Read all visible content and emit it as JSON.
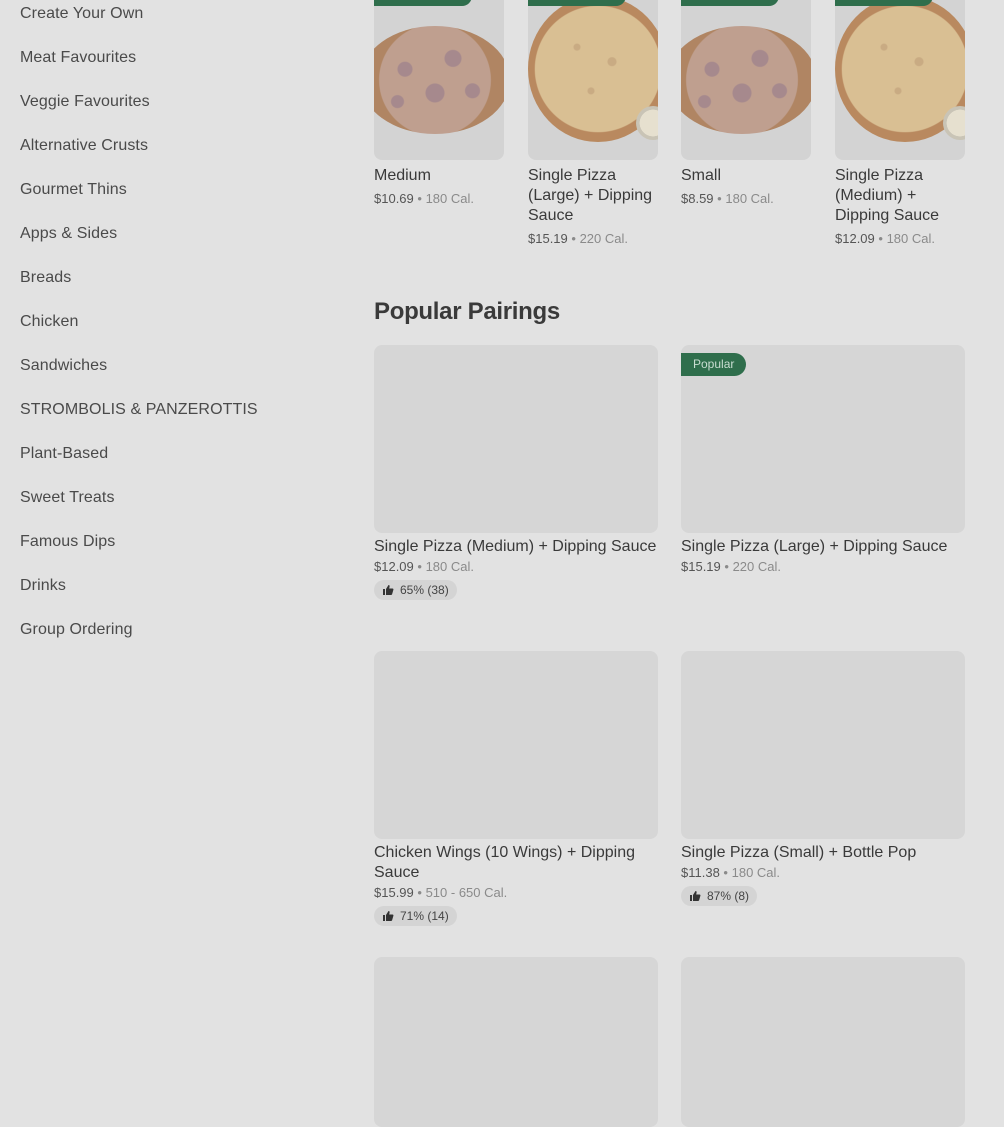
{
  "sidebar": {
    "items": [
      {
        "label": "Create Your Own"
      },
      {
        "label": "Meat Favourites"
      },
      {
        "label": "Veggie Favourites"
      },
      {
        "label": "Alternative Crusts"
      },
      {
        "label": "Gourmet Thins"
      },
      {
        "label": "Apps & Sides"
      },
      {
        "label": "Breads"
      },
      {
        "label": "Chicken"
      },
      {
        "label": "Sandwiches"
      },
      {
        "label": "STROMBOLIS & PANZEROTTIS"
      },
      {
        "label": "Plant-Based"
      },
      {
        "label": "Sweet Treats"
      },
      {
        "label": "Famous Dips"
      },
      {
        "label": "Drinks"
      },
      {
        "label": "Group Ordering"
      }
    ]
  },
  "top_items": [
    {
      "name": "Medium",
      "price": "$10.69",
      "cal": "180 Cal.",
      "image": "ham-pizza"
    },
    {
      "name": "Single Pizza (Large) + Dipping Sauce",
      "price": "$15.19",
      "cal": "220 Cal.",
      "image": "cheese-pizza-with-dip"
    },
    {
      "name": "Small",
      "price": "$8.59",
      "cal": "180 Cal.",
      "image": "ham-pizza"
    },
    {
      "name": "Single Pizza (Medium) + Dipping Sauce",
      "price": "$12.09",
      "cal": "180 Cal.",
      "image": "cheese-pizza-with-dip"
    }
  ],
  "popular_pairings": {
    "title": "Popular Pairings",
    "items": [
      {
        "name": "Single Pizza (Medium) + Dipping Sauce",
        "price": "$12.09",
        "cal": "180 Cal.",
        "rating": "65% (38)"
      },
      {
        "name": "Single Pizza (Large) + Dipping Sauce",
        "price": "$15.19",
        "cal": "220 Cal.",
        "badge": "Popular"
      },
      {
        "name": "Chicken Wings (10 Wings) + Dipping Sauce",
        "price": "$15.99",
        "cal": "510 - 650 Cal.",
        "rating": "71% (14)"
      },
      {
        "name": "Single Pizza (Small) + Bottle Pop",
        "price": "$11.38",
        "cal": "180 Cal.",
        "rating": "87% (8)"
      }
    ]
  },
  "separator": "•",
  "colors": {
    "badge": "#2f6e4c",
    "overlay_background": "#e2e2e2",
    "image_placeholder": "#d6d6d6"
  },
  "icons": {
    "rating": "thumbs-up-icon"
  }
}
